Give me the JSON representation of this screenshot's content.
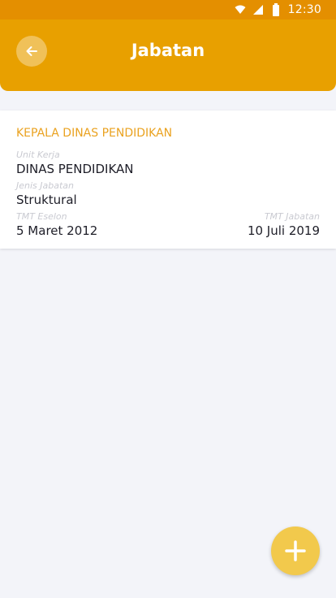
{
  "status_bar": {
    "time": "12:30",
    "icons": [
      "wifi-icon",
      "signal-icon",
      "battery-icon"
    ]
  },
  "header": {
    "title": "Jabatan",
    "back_icon": "arrow-left-icon",
    "color": "#e8a000"
  },
  "card": {
    "title": "KEPALA DINAS PENDIDIKAN",
    "unit_kerja_label": "Unit Kerja",
    "unit_kerja_value": "DINAS PENDIDIKAN",
    "jenis_jabatan_label": "Jenis Jabatan",
    "jenis_jabatan_value": "Struktural",
    "tmt_eselon_label": "TMT Eselon",
    "tmt_eselon_value": "5 Maret 2012",
    "tmt_jabatan_label": "TMT Jabatan",
    "tmt_jabatan_value": "10 Juli 2019",
    "accent_color": "#eaa220"
  },
  "fab": {
    "icon": "plus-icon",
    "color": "#f2c94c"
  }
}
